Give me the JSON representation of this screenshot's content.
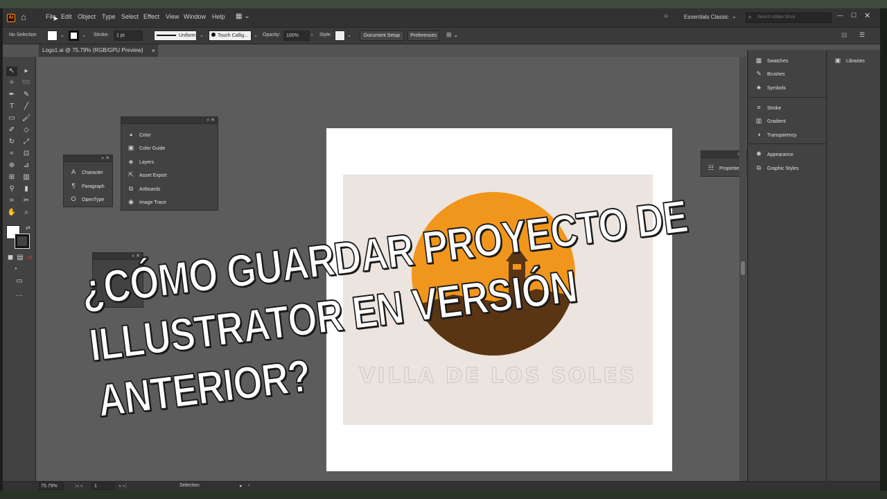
{
  "menu": {
    "items": [
      "File",
      "Edit",
      "Object",
      "Type",
      "Select",
      "Effect",
      "View",
      "Window",
      "Help"
    ],
    "logo": "Ai",
    "workspace": "Essentials Classic",
    "search_placeholder": "Search Adobe Stock"
  },
  "control": {
    "selection": "No Selection",
    "stroke_label": "Stroke:",
    "stroke_value": "1 pt",
    "stroke_profile": "Uniform",
    "brush": "Touch Callig...",
    "opacity_label": "Opacity:",
    "opacity_value": "100%",
    "style_label": "Style:",
    "document_setup": "Document Setup",
    "preferences": "Preferences"
  },
  "document": {
    "tab_title": "Logo1.ai @ 75.79% (RGB/GPU Preview)",
    "close": "×"
  },
  "artwork": {
    "logo_text": "VILLA DE LOS SOLES",
    "sun_color": "#f1961c",
    "ground_color": "#5a3514",
    "background_color": "#ebe4df"
  },
  "panels": {
    "type_panel": [
      "Character",
      "Paragraph",
      "OpenType"
    ],
    "color_panel": [
      "Color",
      "Color Guide",
      "Layers",
      "Asset Export",
      "Artboards",
      "Image Trace"
    ],
    "properties": "Properties"
  },
  "dock": {
    "col1": [
      "Swatches",
      "Brushes",
      "Symbols",
      "Stroke",
      "Gradient",
      "Transparency",
      "Appearance",
      "Graphic Styles"
    ],
    "col2": [
      "Libraries"
    ]
  },
  "status": {
    "zoom": "75.79%",
    "artboard": "1",
    "tool": "Selection"
  },
  "overlay": {
    "line1": "¿CÓMO GUARDAR PROYECTO DE",
    "line2": "ILLUSTRATOR EN VERSIÓN",
    "line3": "ANTERIOR?"
  }
}
